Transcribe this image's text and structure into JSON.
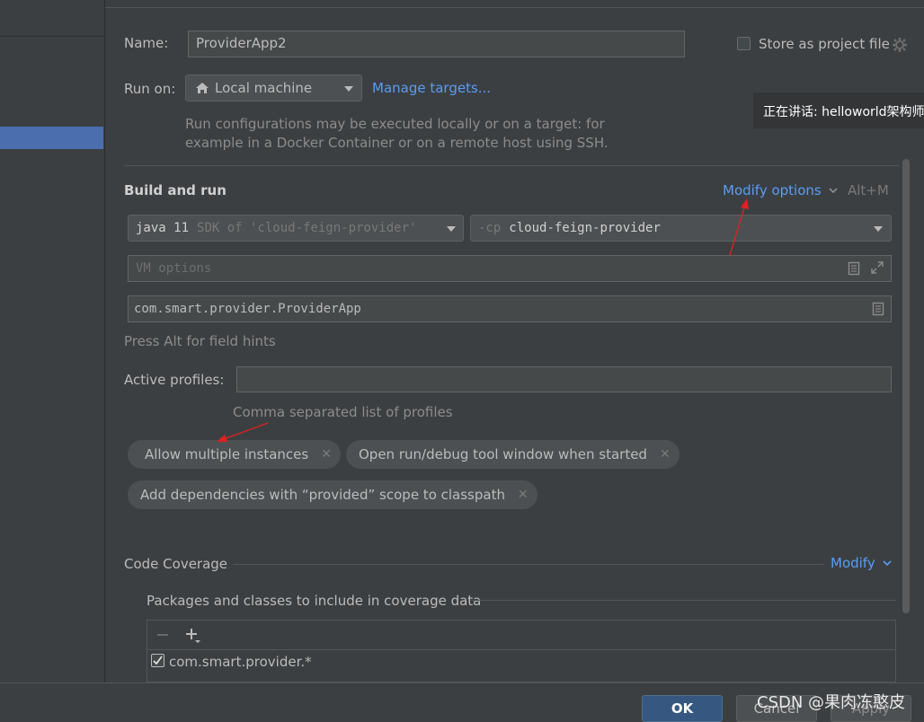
{
  "form": {
    "name_label": "Name:",
    "name_value": "ProviderApp2",
    "store_label": "Store as project file",
    "run_on_label": "Run on:",
    "run_on_value": "Local machine",
    "manage_targets": "Manage targets...",
    "run_info_line1": "Run configurations may be executed locally or on a target: for",
    "run_info_line2": "example in a Docker Container or on a remote host using SSH."
  },
  "build": {
    "title": "Build and run",
    "modify_options": "Modify options",
    "modify_shortcut": "Alt+M",
    "jdk_main": "java 11",
    "jdk_hint": "SDK of 'cloud-feign-provider'",
    "cp_prefix": "-cp",
    "cp_value": "cloud-feign-provider",
    "vm_placeholder": "VM options",
    "main_class": "com.smart.provider.ProviderApp",
    "field_hint": "Press Alt for field hints",
    "profiles_label": "Active profiles:",
    "profiles_value": "",
    "profiles_hint": "Comma separated list of profiles"
  },
  "chips": [
    {
      "label": "Allow multiple instances"
    },
    {
      "label": "Open run/debug tool window when started"
    },
    {
      "label": "Add dependencies with “provided” scope to classpath"
    }
  ],
  "coverage": {
    "title": "Code Coverage",
    "modify": "Modify",
    "packages_label": "Packages and classes to include in coverage data",
    "items": [
      {
        "label": "com.smart.provider.*",
        "checked": true
      }
    ]
  },
  "footer": {
    "ok": "OK",
    "cancel": "Cancel",
    "apply": "Apply"
  },
  "overlay": {
    "speaking": "正在讲话: helloworld架构师",
    "watermark": "CSDN @果肉冻憨皮"
  },
  "colors": {
    "accent": "#589df6",
    "annotation_arrow": "#e02020",
    "selection": "#4b6eaf"
  },
  "icons": [
    "home-icon",
    "gear-icon",
    "dropdown-arrow-icon",
    "chevron-down-icon",
    "document-icon",
    "expand-icon",
    "close-icon",
    "minus-icon",
    "plus-icon",
    "checkbox-icon"
  ]
}
